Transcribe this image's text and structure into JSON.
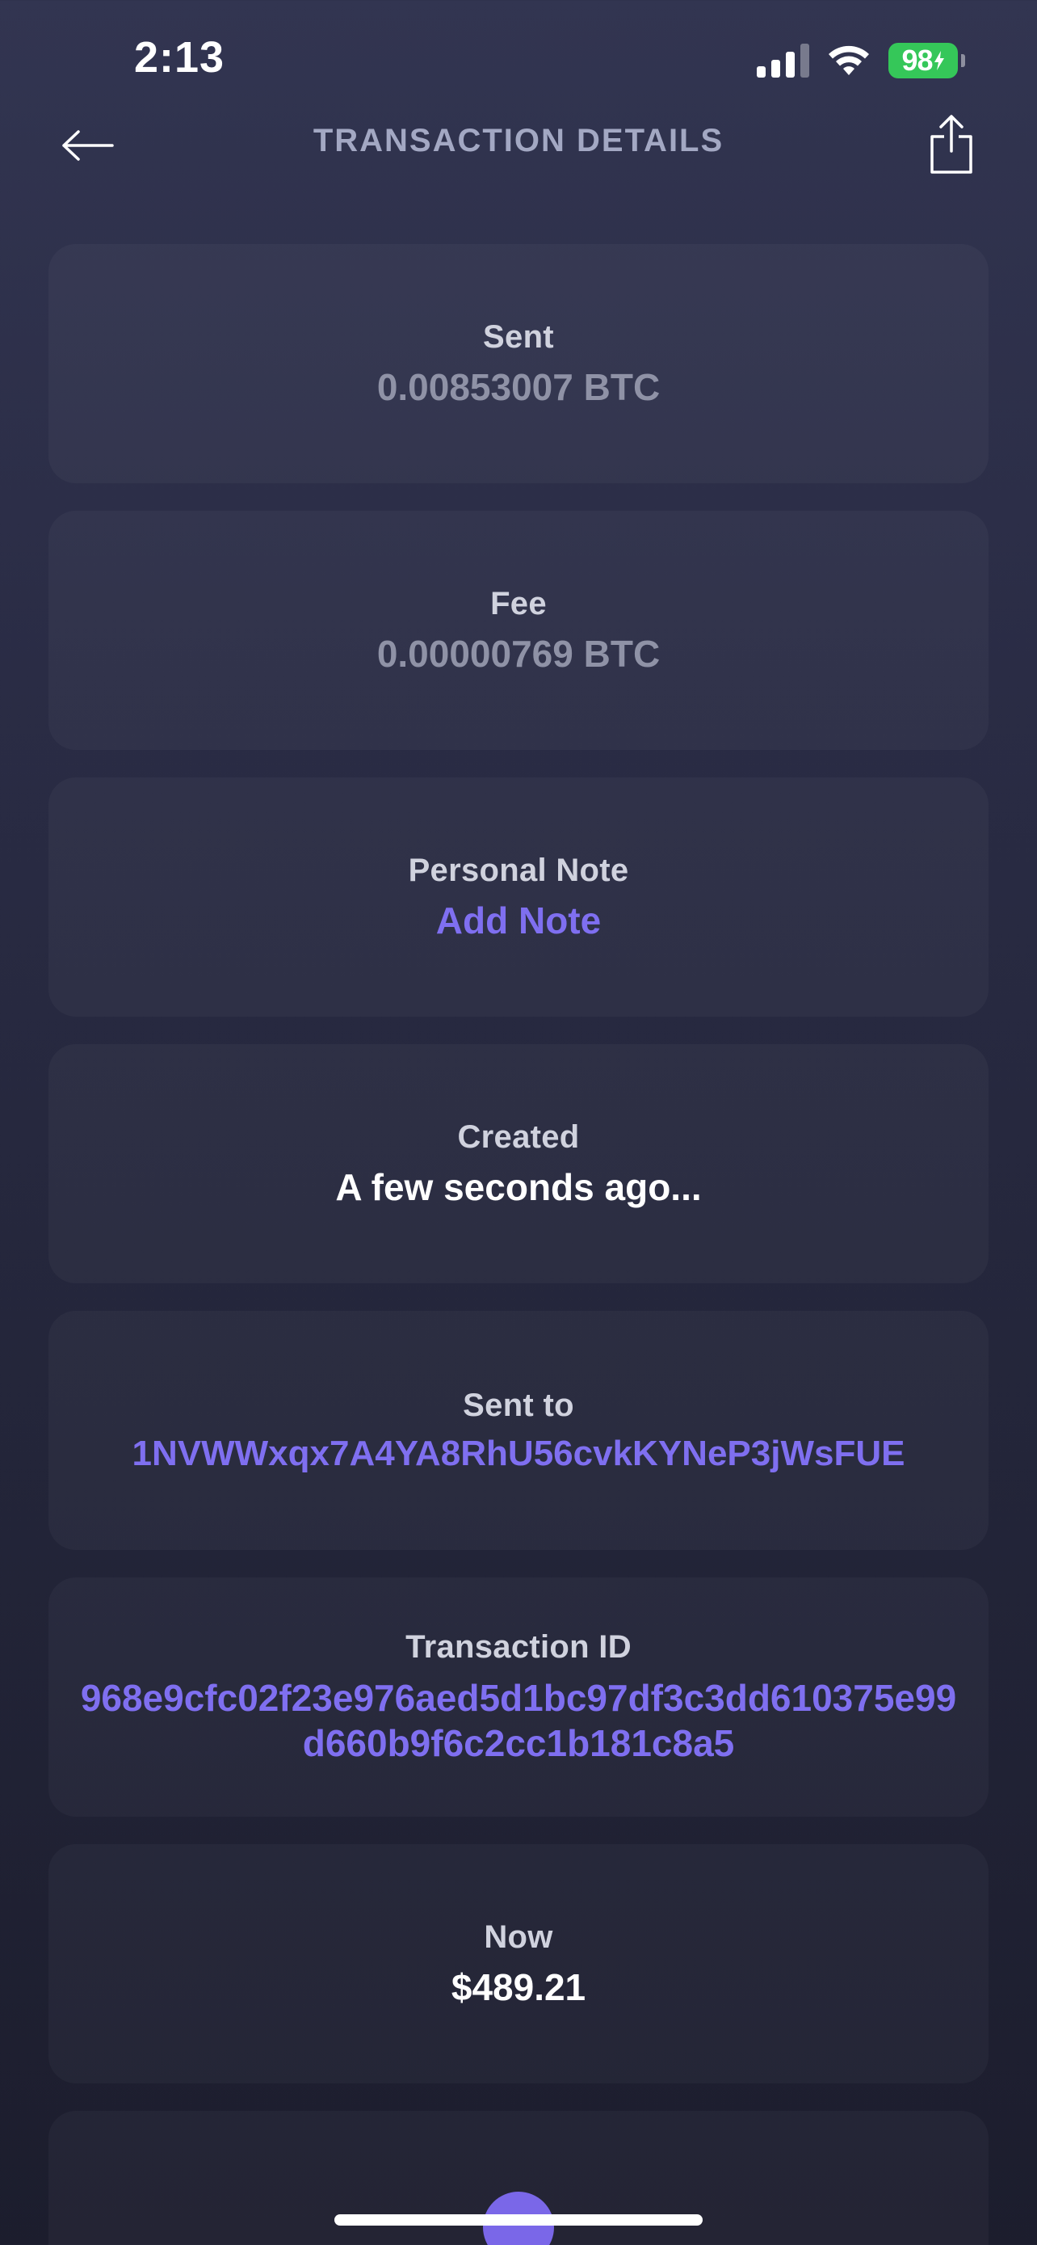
{
  "status_bar": {
    "time": "2:13",
    "battery": "98"
  },
  "header": {
    "title": "TRANSACTION DETAILS",
    "back_icon": "arrow-left-icon",
    "share_icon": "share-icon"
  },
  "cards": {
    "sent": {
      "label": "Sent",
      "value": "0.00853007 BTC"
    },
    "fee": {
      "label": "Fee",
      "value": "0.00000769 BTC"
    },
    "note": {
      "label": "Personal Note",
      "action": "Add Note"
    },
    "created": {
      "label": "Created",
      "value": "A few seconds ago..."
    },
    "sent_to": {
      "label": "Sent to",
      "value": "1NVWWxqx7A4YA8RhU56cvkKYNeP3jWsFUE"
    },
    "tx_id": {
      "label": "Transaction ID",
      "value": "968e9cfc02f23e976aed5d1bc97df3c3dd610375e99d660b9f6c2cc1b181c8a5"
    },
    "now": {
      "label": "Now",
      "value": "$489.21"
    }
  },
  "colors": {
    "accent": "#7f6ff0",
    "battery": "#35c759",
    "header_title": "#a3a8c3"
  }
}
